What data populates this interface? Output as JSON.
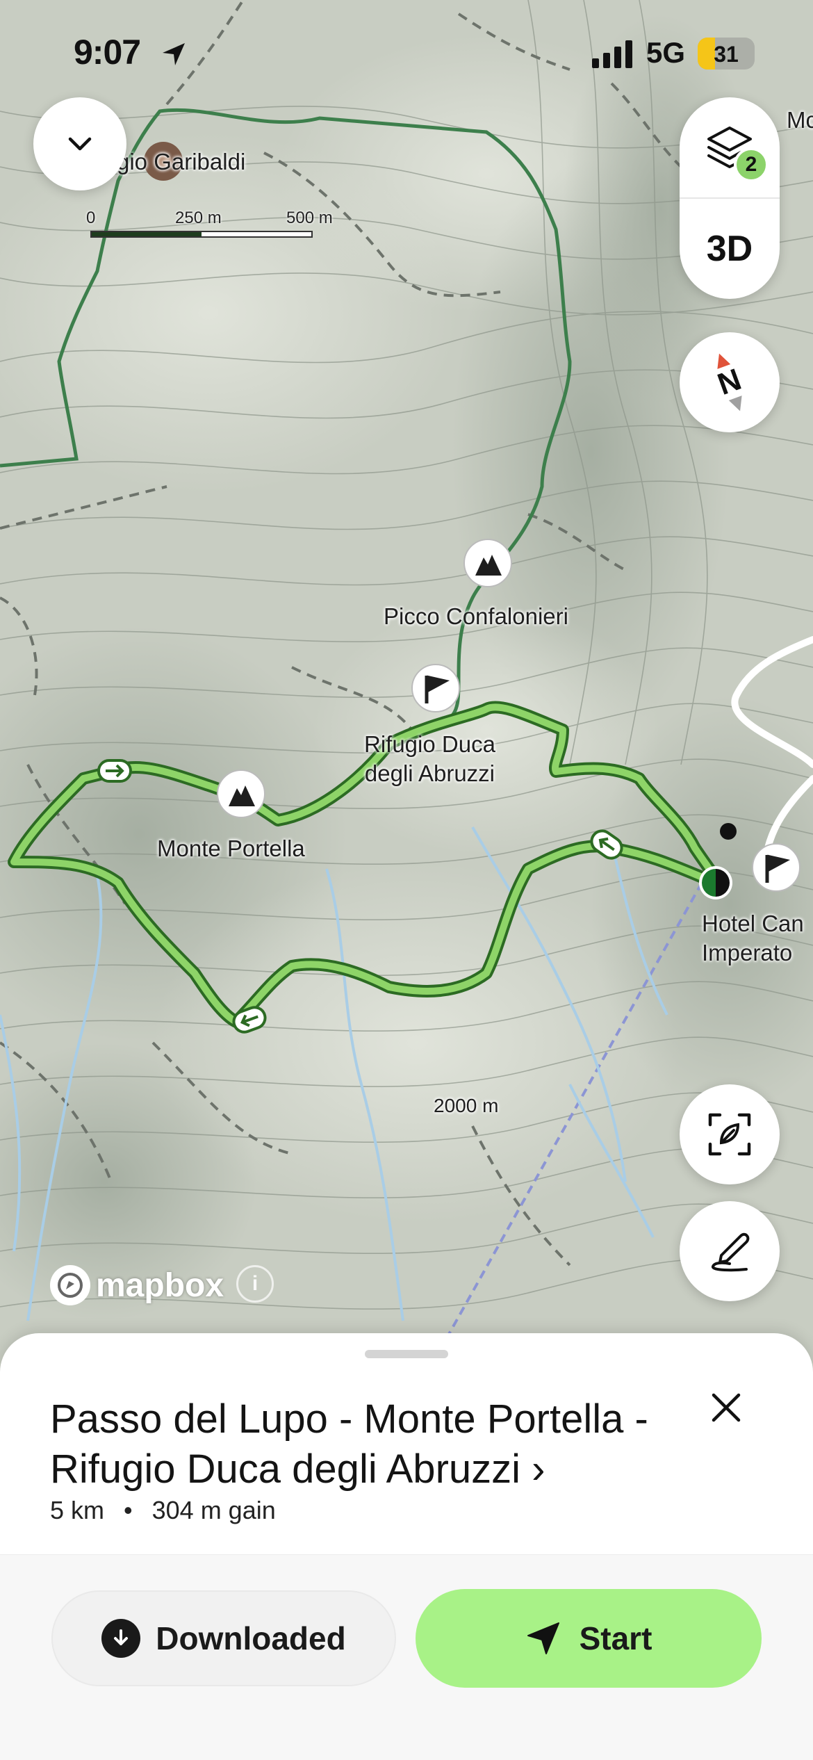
{
  "status_bar": {
    "time": "9:07",
    "network": "5G",
    "battery_level": "31",
    "battery_fraction": 0.31,
    "location_icon": "location-arrow-icon",
    "signal_icon": "cellular-signal-icon"
  },
  "map": {
    "scale": {
      "zero": "0",
      "mid": "250 m",
      "end": "500 m"
    },
    "labels": {
      "refuge_partial": "gio Garibaldi",
      "corner_partial": "Mc",
      "peak_1": "Picco Confalonieri",
      "refuge_1": "Rifugio Duca\ndegli Abruzzi",
      "peak_2": "Monte Portella",
      "hotel_partial": "Hotel Can\nImperato",
      "elevation": "2000 m"
    },
    "attribution": "mapbox",
    "info_glyph": "i",
    "colors": {
      "route": "#8ed468",
      "route_outline": "#2c6b23",
      "trail": "#3d7f4c",
      "water": "#a9cde6"
    }
  },
  "controls": {
    "collapse_icon": "chevron-down-icon",
    "layers_icon": "layers-icon",
    "layers_badge": "2",
    "toggle_3d": "3D",
    "compass_icon": "compass-icon",
    "compass_letter": "N",
    "recenter_icon": "recenter-icon",
    "draw_icon": "draw-route-icon"
  },
  "route": {
    "title": "Passo del Lupo - Monte Portella - Rifugio Duca degli Abruzzi ›",
    "distance": "5 km",
    "separator": "•",
    "gain": "304 m gain",
    "close_icon": "close-icon"
  },
  "actions": {
    "downloaded_label": "Downloaded",
    "downloaded_icon": "download-circle-icon",
    "start_label": "Start",
    "start_icon": "navigation-arrow-icon"
  }
}
